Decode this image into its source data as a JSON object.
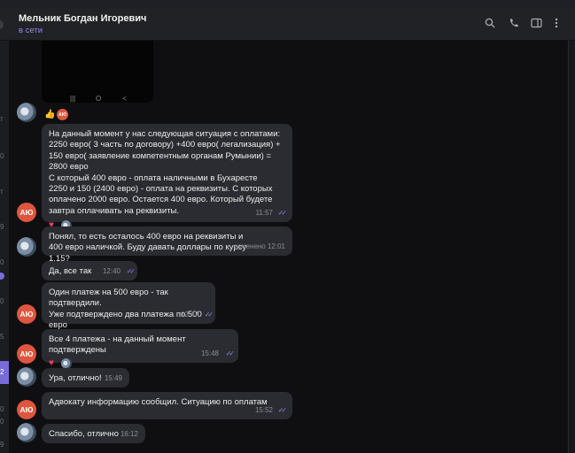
{
  "header": {
    "title": "Мельник Богдан Игоревич",
    "status": "в сети",
    "icons": [
      "search-icon",
      "phone-icon",
      "sidebar-icon",
      "more-icon"
    ]
  },
  "left_strip": {
    "labels": [
      {
        "text": "т"
      },
      {
        "text": "0"
      },
      {
        "text": "т"
      },
      {
        "text": "9"
      },
      {
        "text": "0"
      },
      {
        "text": "0"
      },
      {
        "text": "5"
      },
      {
        "text": "2"
      },
      {
        "text": "0"
      },
      {
        "text": "0"
      },
      {
        "text": "9"
      }
    ]
  },
  "phone_nav": [
    "|||",
    "O",
    "<"
  ],
  "messages": [
    {
      "kind": "reaction-only",
      "author": "photo",
      "mini_label": "АЮ"
    },
    {
      "kind": "bubble",
      "author": "АЮ",
      "text": "На данный момент у нас следующая ситуация с оплатами:\n2250 евро( 3 часть по договору) +400 евро( легализация) + 150 евро( заявление компетентным органам Румынии) = 2800 евро\nС который 400 евро - оплата наличными в Бухаресте\n2250 и 150 (2400 евро)  - оплата на реквизиты. С которых оплачено 2000 евро. Остается 400 евро. Который будете завтра оплачивать на реквизиты.",
      "time": "11:57",
      "reaction": "heart"
    },
    {
      "kind": "bubble",
      "author": "photo",
      "text": "Понял, то есть осталось 400 евро на реквизиты и 400 евро наличкой. Буду давать доллары по курсу 1.15?",
      "time": "изменено 12:01"
    },
    {
      "kind": "bubble",
      "author": "АЮ",
      "text": "Да, все так",
      "time": "12:40"
    },
    {
      "kind": "bubble",
      "author": "АЮ",
      "text": "Один платеж на 500 евро - так подтвердили.\nУже подтверждено два платежа по 500 евро",
      "time": "12:47",
      "reaction": "thumb"
    },
    {
      "kind": "bubble",
      "author": "АЮ",
      "text": "Все 4 платежа - на данный момент подтверждены",
      "time": "15:48",
      "reaction": "heart"
    },
    {
      "kind": "bubble",
      "author": "photo",
      "text": "Ура, отлично!",
      "time": "15:49"
    },
    {
      "kind": "bubble",
      "author": "АЮ",
      "text": "Адвокату информацию сообщил. Ситуацию по оплатам",
      "time": "15:52"
    },
    {
      "kind": "bubble",
      "author": "photo",
      "text": "Спасибо, отлично",
      "time": "16:12"
    }
  ]
}
